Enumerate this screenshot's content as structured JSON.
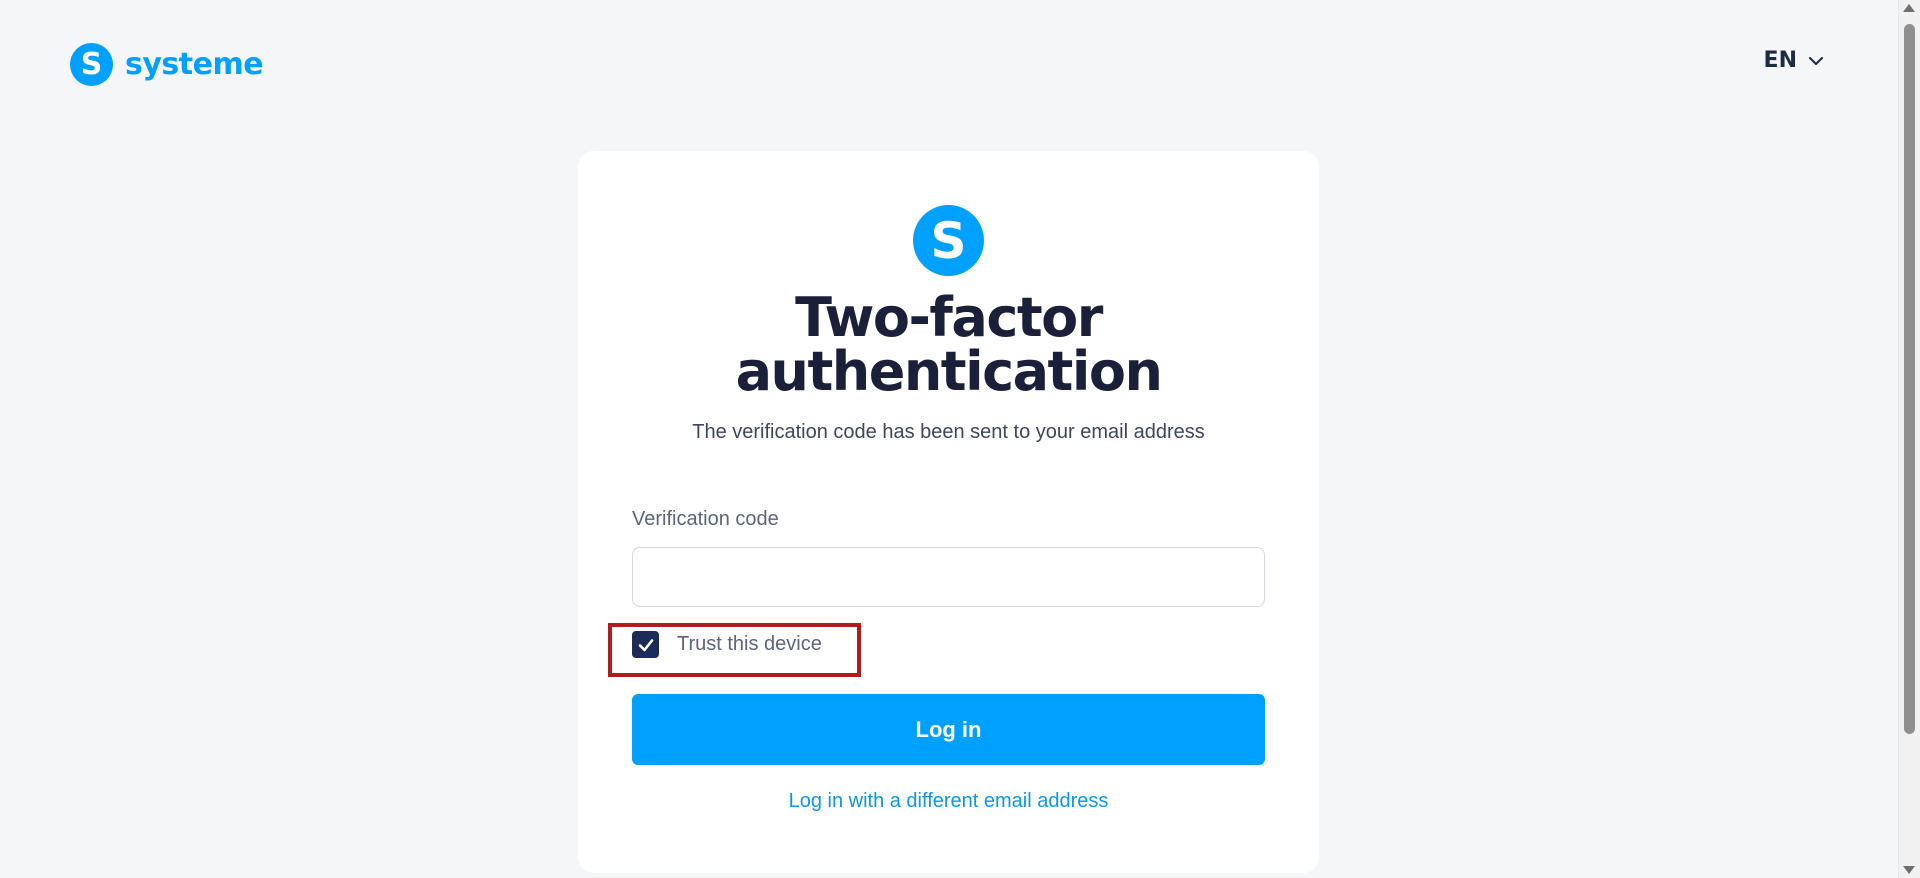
{
  "header": {
    "logo_mark": "S",
    "logo_text": "systeme",
    "language": "EN"
  },
  "card": {
    "logo_mark": "S",
    "title_line1": "Two-factor",
    "title_line2": "authentication",
    "subtitle": "The verification code has been sent to your email address",
    "field_label": "Verification code",
    "field_value": "",
    "trust_label": "Trust this device",
    "trust_checked": true,
    "login_button": "Log in",
    "alt_link": "Log in with a different email address"
  },
  "colors": {
    "brand": "#00a0ff",
    "title": "#1a1f3a",
    "checkbox": "#1d2b5a",
    "highlight": "#b01c1c",
    "background": "#f5f6f8"
  }
}
